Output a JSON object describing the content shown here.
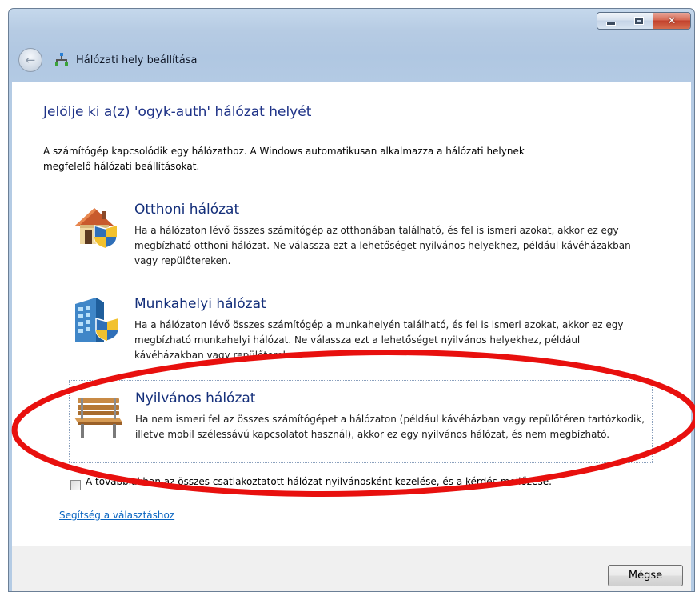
{
  "window": {
    "caption_buttons": {
      "minimize": "minimize",
      "maximize": "maximize",
      "close": "close"
    }
  },
  "nav": {
    "title": "Hálózati hely beállítása",
    "back_icon": "back-arrow-icon",
    "network_icon": "network-icon"
  },
  "heading": "Jelölje ki a(z) 'ogyk-auth' hálózat helyét",
  "intro": "A számítógép kapcsolódik egy hálózathoz. A Windows automatikusan alkalmazza a hálózati helynek megfelelő hálózati beállításokat.",
  "options": [
    {
      "title": "Otthoni hálózat",
      "description": "Ha a hálózaton lévő összes számítógép az otthonában található, és fel is ismeri azokat, akkor ez egy megbízható otthoni hálózat. Ne válassza ezt a lehetőséget nyilvános helyekhez, például kávéházakban vagy repülőtereken.",
      "icon": "home-shield-icon"
    },
    {
      "title": "Munkahelyi hálózat",
      "description": "Ha a hálózaton lévő összes számítógép a munkahelyén található, és fel is ismeri azokat, akkor ez egy megbízható munkahelyi hálózat. Ne válassza ezt a lehetőséget nyilvános helyekhez, például kávéházakban vagy repülőtereken.",
      "icon": "office-building-shield-icon"
    },
    {
      "title": "Nyilvános hálózat",
      "description": "Ha nem ismeri fel az összes számítógépet a hálózaton (például kávéházban vagy repülőtéren tartózkodik, illetve mobil szélessávú kapcsolatot használ), akkor ez egy nyilvános hálózat, és nem megbízható.",
      "icon": "park-bench-icon"
    }
  ],
  "checkbox": {
    "label": "A továbbiakban az összes csatlakoztatott hálózat nyilvánosként kezelése, és a kérdés mellőzése.",
    "checked": false
  },
  "help_link": "Segítség a választáshoz",
  "footer": {
    "cancel_label": "Mégse"
  },
  "colors": {
    "heading": "#1e3287",
    "option_title": "#142f7a",
    "link": "#0b66c2",
    "annotation": "#e8100e"
  }
}
